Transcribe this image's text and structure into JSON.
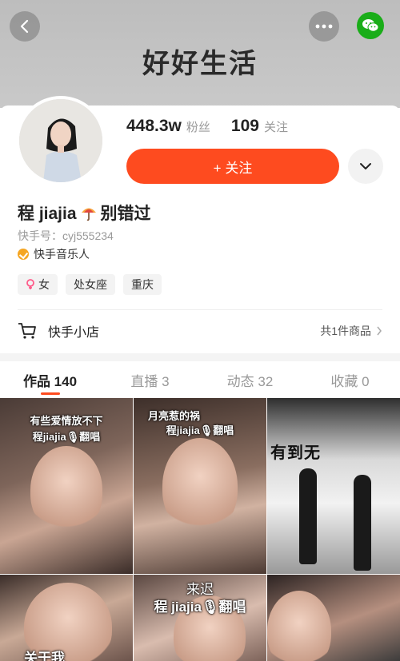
{
  "header": {
    "title": "好好生活"
  },
  "profile": {
    "followers_count": "448.3w",
    "followers_label": "粉丝",
    "following_count": "109",
    "following_label": "关注",
    "follow_button": "+ 关注",
    "name_prefix": "程 jiajia",
    "name_suffix": "别错过",
    "kuaishou_id": "快手号：cyj555234",
    "verification": "快手音乐人",
    "tags": [
      "女",
      "处女座",
      "重庆"
    ]
  },
  "shop": {
    "label": "快手小店",
    "count": "共1件商品"
  },
  "tabs": [
    {
      "label": "作品 140",
      "active": true
    },
    {
      "label": "直播 3",
      "active": false
    },
    {
      "label": "动态 32",
      "active": false
    },
    {
      "label": "收藏 0",
      "active": false
    }
  ],
  "posts": [
    {
      "caption_line1": "有些爱情放不下",
      "caption_line2": "程jiajia🎙翻唱"
    },
    {
      "caption_line1": "月亮惹的祸",
      "caption_line2": "程jiajia🎙翻唱"
    },
    {
      "caption_line1": "有到无"
    },
    {
      "caption_line1": "关于我"
    },
    {
      "caption_line1": "来迟",
      "caption_line2": "程 jiajia🎙翻唱"
    },
    {
      "caption_line1": ""
    }
  ],
  "colors": {
    "accent": "#fe4b1f",
    "wechat": "#1aad19"
  }
}
